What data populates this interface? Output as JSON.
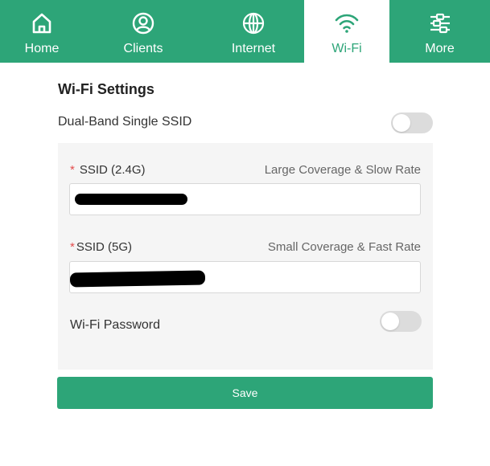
{
  "nav": {
    "items": [
      {
        "label": "Home",
        "icon": "home-icon"
      },
      {
        "label": "Clients",
        "icon": "user-icon"
      },
      {
        "label": "Internet",
        "icon": "globe-icon"
      },
      {
        "label": "Wi-Fi",
        "icon": "wifi-icon"
      },
      {
        "label": "More",
        "icon": "sliders-icon"
      }
    ],
    "active": "Wi-Fi"
  },
  "page": {
    "title": "Wi-Fi Settings",
    "dual_band": {
      "label": "Dual-Band Single SSID",
      "enabled": false
    },
    "ssid_24": {
      "label": "SSID (2.4G)",
      "hint": "Large Coverage & Slow Rate",
      "value": ""
    },
    "ssid_5": {
      "label": "SSID (5G)",
      "hint": "Small Coverage & Fast Rate",
      "value": ""
    },
    "wifi_password": {
      "label": "Wi-Fi Password",
      "enabled": false
    },
    "save_label": "Save"
  },
  "colors": {
    "primary": "#2da578",
    "required": "#e34d4d",
    "panel": "#f5f5f5"
  }
}
